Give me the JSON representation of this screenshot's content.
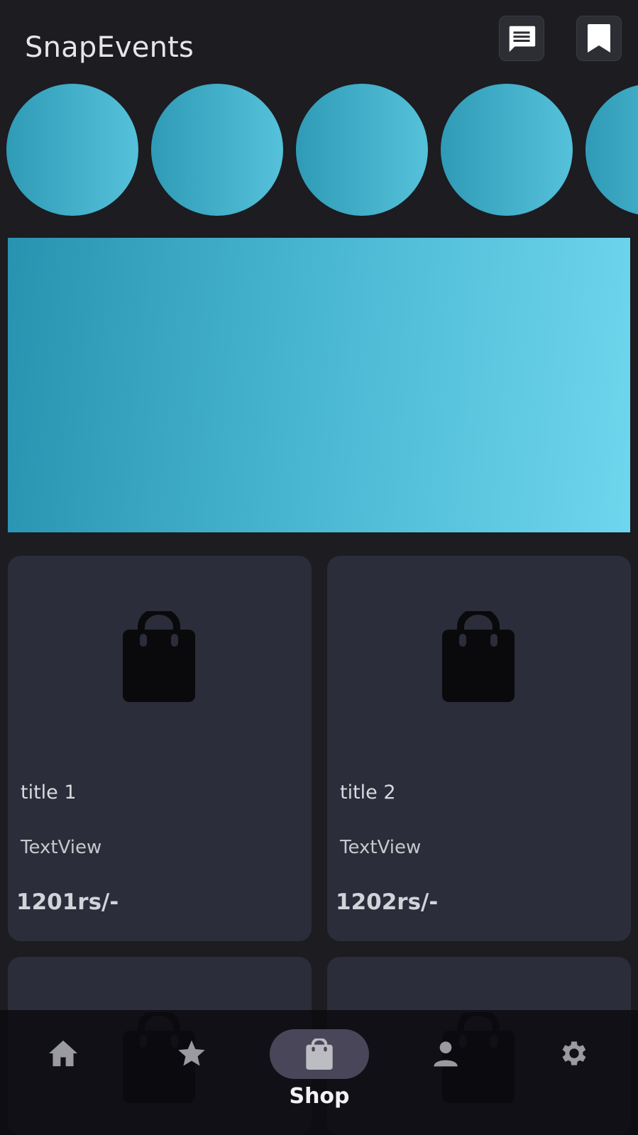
{
  "header": {
    "title": "SnapEvents",
    "chat_icon": "chat-icon",
    "bookmark_icon": "bookmark-icon"
  },
  "stories": {
    "count_visible": 5,
    "gradient": [
      "#2f9bb6",
      "#55c1da"
    ]
  },
  "banner": {
    "gradient": [
      "#2893b0",
      "#6ed6ed"
    ]
  },
  "products": [
    {
      "title": "title 1",
      "description": "TextView",
      "price": "1201rs/-",
      "icon": "shopping-bag-icon"
    },
    {
      "title": "title 2",
      "description": "TextView",
      "price": "1202rs/-",
      "icon": "shopping-bag-icon"
    },
    {
      "title": "",
      "description": "",
      "price": "",
      "icon": "shopping-bag-icon"
    },
    {
      "title": "",
      "description": "",
      "price": "",
      "icon": "shopping-bag-icon"
    }
  ],
  "bottom_nav": {
    "items": [
      {
        "id": "home",
        "icon": "home-icon"
      },
      {
        "id": "favorites",
        "icon": "star-icon"
      },
      {
        "id": "shop",
        "icon": "shopping-bag-icon",
        "label": "Shop",
        "active": true
      },
      {
        "id": "profile",
        "icon": "person-icon"
      },
      {
        "id": "settings",
        "icon": "gear-icon"
      }
    ]
  },
  "colors": {
    "background": "#1c1c21",
    "card": "#2b2d3a",
    "accent": "#55c1da",
    "nav_active_pill": "#4a4659"
  }
}
